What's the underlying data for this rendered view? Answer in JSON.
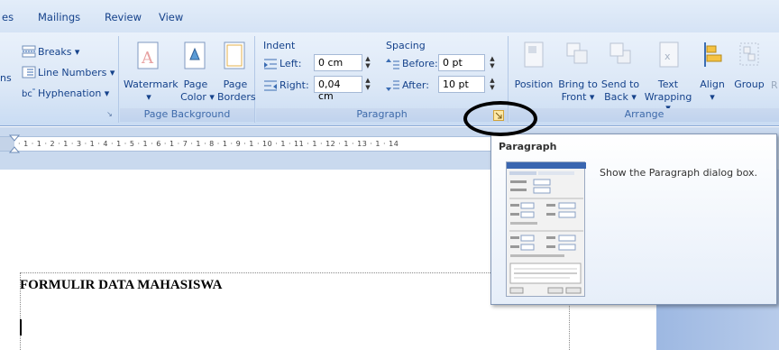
{
  "tabs": {
    "partial": "es",
    "mailings": "Mailings",
    "review": "Review",
    "view": "View"
  },
  "page_setup": {
    "breaks": "Breaks ▾",
    "line_numbers": "Line Numbers ▾",
    "hyphenation": "Hyphenation ▾",
    "partial_left": "ns"
  },
  "page_background": {
    "watermark": "Watermark",
    "watermark_arrow": "▾",
    "page_color_1": "Page",
    "page_color_2": "Color ▾",
    "page_borders_1": "Page",
    "page_borders_2": "Borders",
    "group_label": "Page Background"
  },
  "paragraph": {
    "indent_header": "Indent",
    "spacing_header": "Spacing",
    "left_label": "Left:",
    "left_value": "0 cm",
    "right_label": "Right:",
    "right_value": "0,04 cm",
    "before_label": "Before:",
    "before_value": "0 pt",
    "after_label": "After:",
    "after_value": "10 pt",
    "group_label": "Paragraph"
  },
  "arrange": {
    "position": "Position",
    "bring_to_front_1": "Bring to",
    "bring_to_front_2": "Front ▾",
    "send_to_back_1": "Send to",
    "send_to_back_2": "Back ▾",
    "text_wrapping_1": "Text",
    "text_wrapping_2": "Wrapping ▾",
    "align": "Align",
    "align_arrow": "▾",
    "group": "Group",
    "partial_right": "R",
    "group_label": "Arrange"
  },
  "ruler": {
    "ticks": "· 1 · 1 · 2 · 1 · 3 · 1 · 4 · 1 · 5 · 1 · 6 · 1 · 7 · 1 · 8 · 1 · 9 · 1 · 10 · 1 · 11 · 1 · 12 · 1 · 13 · 1 · 14"
  },
  "tooltip": {
    "title": "Paragraph",
    "description": "Show the Paragraph dialog box."
  },
  "document": {
    "heading": "FORMULIR DATA MAHASISWA"
  },
  "colors": {
    "ribbon_text": "#15428b",
    "ribbon_bg": "#dbe7f6",
    "highlight": "#000000"
  }
}
